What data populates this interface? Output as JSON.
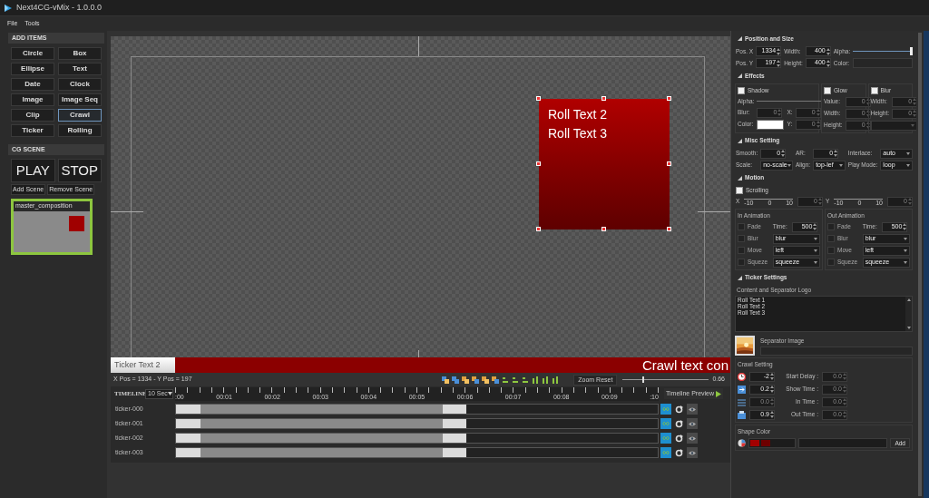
{
  "window": {
    "title": "Next4CG-vMix - 1.0.0.0"
  },
  "menu": [
    "File",
    "Tools"
  ],
  "add_items": {
    "title": "ADD ITEMS",
    "buttons": [
      {
        "label": "Circle",
        "selected": false
      },
      {
        "label": "Box",
        "selected": false
      },
      {
        "label": "Ellipse",
        "selected": false
      },
      {
        "label": "Text",
        "selected": false
      },
      {
        "label": "Date",
        "selected": false
      },
      {
        "label": "Clock",
        "selected": false
      },
      {
        "label": "Image",
        "selected": false
      },
      {
        "label": "Image Seq",
        "selected": false
      },
      {
        "label": "Clip",
        "selected": false
      },
      {
        "label": "Crawl",
        "selected": true
      },
      {
        "label": "Ticker",
        "selected": false
      },
      {
        "label": "Rolling",
        "selected": false
      }
    ]
  },
  "cg_scene": {
    "title": "CG SCENE",
    "play": "PLAY",
    "stop": "STOP",
    "add_scene": "Add Scene",
    "remove_scene": "Remove Scene",
    "scenes": [
      {
        "name": "master_composition",
        "selected": true
      }
    ]
  },
  "canvas": {
    "box_lines": [
      "Roll Text 2",
      "Roll Text 3"
    ],
    "ticker_label": "Ticker Text 2",
    "crawl_text": "Crawl text con"
  },
  "toolbar": {
    "position": "X Pos = 1334 - Y Pos = 197",
    "zoom_reset": "Zoom Reset",
    "zoom": {
      "level": 0.24
    },
    "zoom_value": "0.66"
  },
  "timeline": {
    "title": "TIMELINE",
    "duration": "10 Sec",
    "ticks": [
      ":00",
      "00:01",
      "00:02",
      "00:03",
      "00:04",
      "00:05",
      "00:06",
      "00:07",
      "00:08",
      "00:09",
      ":10"
    ],
    "preview": "Timeline Preview",
    "tracks": [
      {
        "name": "ticker-000"
      },
      {
        "name": "ticker-001"
      },
      {
        "name": "ticker-002"
      },
      {
        "name": "ticker-003"
      }
    ]
  },
  "properties": {
    "sections": [
      {
        "title": "Position and Size",
        "parts": [
          {
            "kind": "rows",
            "rows": [
              [
                {
                  "kind": "label",
                  "text": "Pos. X"
                },
                {
                  "kind": "spin",
                  "value": "1334",
                  "disabled": false
                },
                {
                  "kind": "label",
                  "text": "Width:"
                },
                {
                  "kind": "spin",
                  "value": "400",
                  "disabled": false
                },
                {
                  "kind": "label",
                  "text": "Alpha:"
                },
                {
                  "kind": "slider",
                  "level": 1
                }
              ],
              [
                {
                  "kind": "label",
                  "text": "Pos. Y"
                },
                {
                  "kind": "spin",
                  "value": "197",
                  "disabled": false
                },
                {
                  "kind": "label",
                  "text": "Height:"
                },
                {
                  "kind": "spin",
                  "value": "400",
                  "disabled": false
                },
                {
                  "kind": "label",
                  "text": "Color:"
                },
                {
                  "kind": "field"
                }
              ]
            ]
          }
        ]
      },
      {
        "title": "Effects",
        "parts": [
          {
            "kind": "columns",
            "columns": [
              {
                "rows": [
                  [
                    {
                      "kind": "check",
                      "text": "Shadow",
                      "checked": false,
                      "disabled": false
                    }
                  ],
                  [
                    {
                      "kind": "label",
                      "text": "Alpha:"
                    },
                    {
                      "kind": "track"
                    }
                  ],
                  [
                    {
                      "kind": "label",
                      "text": "Blur:"
                    },
                    {
                      "kind": "spin",
                      "value": "0",
                      "disabled": true
                    },
                    {
                      "kind": "label",
                      "text": "X:"
                    },
                    {
                      "kind": "spin",
                      "value": "0",
                      "disabled": true
                    }
                  ],
                  [
                    {
                      "kind": "label",
                      "text": "Color:"
                    },
                    {
                      "kind": "swatch",
                      "color": "#ffffff"
                    },
                    {
                      "kind": "label",
                      "text": "Y:"
                    },
                    {
                      "kind": "spin",
                      "value": "0",
                      "disabled": true
                    }
                  ]
                ]
              },
              {
                "rows": [
                  [
                    {
                      "kind": "check",
                      "text": "Glow",
                      "checked": false,
                      "disabled": false
                    }
                  ],
                  [
                    {
                      "kind": "label",
                      "text": "Value:"
                    },
                    {
                      "kind": "spin",
                      "value": "0",
                      "disabled": true
                    }
                  ],
                  [
                    {
                      "kind": "label",
                      "text": "Width:"
                    },
                    {
                      "kind": "spin",
                      "value": "0",
                      "disabled": true
                    }
                  ],
                  [
                    {
                      "kind": "label",
                      "text": "Height:"
                    },
                    {
                      "kind": "spin",
                      "value": "0",
                      "disabled": true
                    }
                  ]
                ]
              },
              {
                "rows": [
                  [
                    {
                      "kind": "check",
                      "text": "Blur",
                      "checked": false,
                      "disabled": false
                    }
                  ],
                  [
                    {
                      "kind": "label",
                      "text": "Width:"
                    },
                    {
                      "kind": "spin",
                      "value": "0",
                      "disabled": true
                    }
                  ],
                  [
                    {
                      "kind": "label",
                      "text": "Height:"
                    },
                    {
                      "kind": "spin",
                      "value": "0",
                      "disabled": true
                    }
                  ],
                  [
                    {
                      "kind": "select",
                      "disabled": true
                    }
                  ]
                ]
              }
            ]
          }
        ]
      },
      {
        "title": "Misc Setting",
        "parts": [
          {
            "kind": "rows",
            "rows": [
              [
                {
                  "kind": "label",
                  "text": "Smooth:"
                },
                {
                  "kind": "spin",
                  "value": "0",
                  "disabled": false
                },
                {
                  "kind": "label",
                  "text": "AR:"
                },
                {
                  "kind": "spin",
                  "value": "0",
                  "disabled": false
                },
                {
                  "kind": "label",
                  "text": "Interlace:"
                },
                {
                  "kind": "select",
                  "value": "auto",
                  "disabled": false
                }
              ],
              [
                {
                  "kind": "label",
                  "text": "Scale:"
                },
                {
                  "kind": "select",
                  "value": "no-scale",
                  "disabled": false
                },
                {
                  "kind": "label",
                  "text": "Align:"
                },
                {
                  "kind": "select",
                  "value": "top-lef",
                  "disabled": false
                },
                {
                  "kind": "label",
                  "text": "Play Mode:"
                },
                {
                  "kind": "select",
                  "value": "loop",
                  "disabled": false
                }
              ]
            ]
          }
        ]
      },
      {
        "title": "Motion",
        "parts": [
          {
            "kind": "rows",
            "rows": [
              [
                {
                  "kind": "check",
                  "text": "Scrolling",
                  "checked": false,
                  "disabled": false
                }
              ]
            ]
          },
          {
            "kind": "rows",
            "rows": [
              [
                {
                  "kind": "label",
                  "text": "X"
                },
                {
                  "kind": "scale",
                  "ticks": [
                    "-10",
                    "0",
                    "10"
                  ]
                },
                {
                  "kind": "spin",
                  "value": "0",
                  "disabled": true
                },
                {
                  "kind": "label",
                  "text": "Y"
                },
                {
                  "kind": "scale",
                  "ticks": [
                    "-10",
                    "0",
                    "10"
                  ]
                },
                {
                  "kind": "spin",
                  "value": "0",
                  "disabled": true
                }
              ]
            ]
          },
          {
            "kind": "columns",
            "columns": [
              {
                "title": "In Animation",
                "rows": [
                  [
                    {
                      "kind": "check",
                      "text": "Fade",
                      "checked": false,
                      "disabled": true
                    },
                    {
                      "kind": "label",
                      "text": "Time:"
                    },
                    {
                      "kind": "spin",
                      "value": "500",
                      "disabled": false
                    }
                  ],
                  [
                    {
                      "kind": "check",
                      "text": "Blur",
                      "checked": false,
                      "disabled": true
                    },
                    {
                      "kind": "select",
                      "value": "blur",
                      "disabled": false
                    }
                  ],
                  [
                    {
                      "kind": "check",
                      "text": "Move",
                      "checked": false,
                      "disabled": true
                    },
                    {
                      "kind": "select",
                      "value": "left",
                      "disabled": false
                    }
                  ],
                  [
                    {
                      "kind": "check",
                      "text": "Squeze",
                      "checked": false,
                      "disabled": true
                    },
                    {
                      "kind": "select",
                      "value": "squeeze",
                      "disabled": false
                    }
                  ]
                ]
              },
              {
                "title": "Out Animation",
                "rows": [
                  [
                    {
                      "kind": "check",
                      "text": "Fade",
                      "checked": false,
                      "disabled": true
                    },
                    {
                      "kind": "label",
                      "text": "Time:"
                    },
                    {
                      "kind": "spin",
                      "value": "500",
                      "disabled": false
                    }
                  ],
                  [
                    {
                      "kind": "check",
                      "text": "Blur",
                      "checked": false,
                      "disabled": true
                    },
                    {
                      "kind": "select",
                      "value": "blur",
                      "disabled": false
                    }
                  ],
                  [
                    {
                      "kind": "check",
                      "text": "Move",
                      "checked": false,
                      "disabled": true
                    },
                    {
                      "kind": "select",
                      "value": "left",
                      "disabled": false
                    }
                  ],
                  [
                    {
                      "kind": "check",
                      "text": "Squeze",
                      "checked": false,
                      "disabled": true
                    },
                    {
                      "kind": "select",
                      "value": "squeeze",
                      "disabled": false
                    }
                  ]
                ]
              }
            ]
          }
        ]
      },
      {
        "title": "Ticker Settings",
        "parts": [
          {
            "kind": "textarea",
            "label": "Content and Separator Logo",
            "lines": [
              "Roll Text 1",
              "Roll Text 2",
              "Roll Text 3"
            ]
          },
          {
            "label": "Separator Image"
          },
          {
            "kind": "crawl",
            "title": "Crawl Setting",
            "rows": [
              [
                {
                  "kind": "spin",
                  "value": "-2",
                  "disabled": false
                },
                {
                  "kind": "label",
                  "text": "Start Delay :"
                },
                {
                  "kind": "spin",
                  "value": "0.0",
                  "disabled": true
                }
              ],
              [
                {
                  "kind": "spin",
                  "value": "0.2",
                  "disabled": false
                },
                {
                  "kind": "label",
                  "text": "Show Time :"
                },
                {
                  "kind": "spin",
                  "value": "0.0",
                  "disabled": true
                }
              ],
              [
                {
                  "kind": "spin",
                  "value": "0.0",
                  "disabled": true
                },
                {
                  "kind": "label",
                  "text": "In Time :"
                },
                {
                  "kind": "spin",
                  "value": "0.0",
                  "disabled": true
                }
              ],
              [
                {
                  "kind": "spin",
                  "value": "0.9",
                  "disabled": false
                },
                {
                  "kind": "label",
                  "text": "Out Time :"
                },
                {
                  "kind": "spin",
                  "value": "0.0",
                  "disabled": true
                }
              ]
            ]
          },
          {
            "kind": "colors",
            "title": "Shape Color",
            "swatches": [
              {
                "color": "#a30000"
              },
              {
                "color": "#6e0000"
              }
            ],
            "add": "Add"
          }
        ]
      }
    ]
  }
}
